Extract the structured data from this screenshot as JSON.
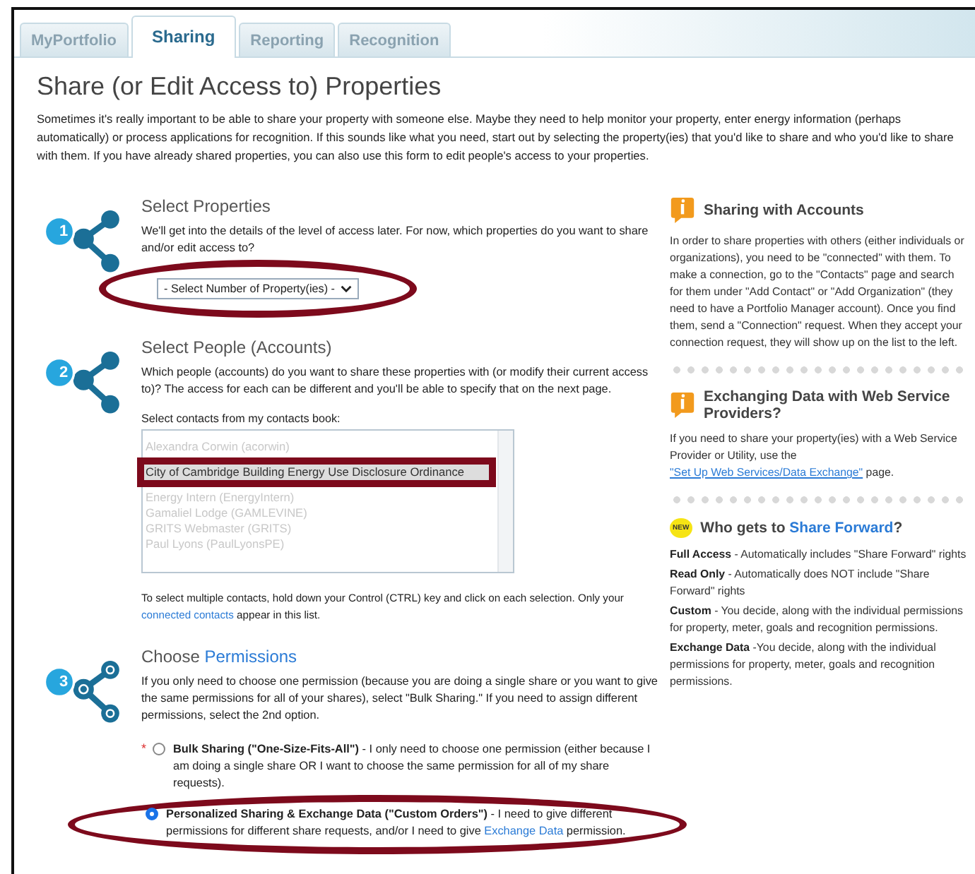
{
  "tabs": [
    {
      "label": "MyPortfolio",
      "selected": false
    },
    {
      "label": "Sharing",
      "selected": true
    },
    {
      "label": "Reporting",
      "selected": false
    },
    {
      "label": "Recognition",
      "selected": false
    }
  ],
  "title": "Share (or Edit Access to) Properties",
  "intro": "Sometimes it's really important to be able to share your property with someone else. Maybe they need to help monitor your property, enter energy information (perhaps automatically) or process applications for recognition. If this sounds like what you need, start out by selecting the property(ies) that you'd like to share and who you'd like to share with them. If you have already shared properties, you can also use this form to edit people's access to your properties.",
  "steps": [
    {
      "number": "1",
      "kind": "select",
      "title": "Select Properties",
      "description": "We'll get into the details of the level of access later. For now, which properties do you want to share and/or edit access to?",
      "select": {
        "value": "- Select Number of Property(ies) -"
      }
    },
    {
      "number": "2",
      "kind": "contacts",
      "title": "Select People (Accounts)",
      "description": "Which people (accounts) do you want to share these properties with (or modify their current access to)? The access for each can be different and you'll be able to specify that on the next page.",
      "list_label": "Select contacts from my contacts book:",
      "contacts": [
        {
          "name": "Alexandra Corwin (acorwin)",
          "selected": false
        },
        {
          "name": "City of Cambridge Building Energy Use Disclosure Ordinance",
          "selected": true
        },
        {
          "name": "Energy Intern (EnergyIntern)",
          "selected": false
        },
        {
          "name": "Gamaliel Lodge (GAMLEVINE)",
          "selected": false
        },
        {
          "name": "GRITS Webmaster (GRITS)",
          "selected": false
        },
        {
          "name": "Paul Lyons (PaulLyonsPE)",
          "selected": false
        }
      ],
      "help": {
        "before": "To select multiple contacts, hold down your Control (CTRL) key and click on each selection. Only your ",
        "link": "connected contacts",
        "after": " appear in this list."
      }
    },
    {
      "number": "3",
      "kind": "permissions",
      "title": "Choose ",
      "title_link": "Permissions",
      "description": "If you only need to choose one permission (because you are doing a single share or you want to give the same permissions for all of your shares), select \"Bulk Sharing.\" If you need to assign different permissions, select the 2nd option.",
      "required_mark": "*",
      "options": [
        {
          "label": "Bulk Sharing (\"One-Size-Fits-All\")",
          "text": " - I only need to choose one permission (either because I am doing a single share OR I want to choose the same permission for all of my share requests).",
          "selected": false
        },
        {
          "label": "Personalized Sharing & Exchange Data (\"Custom Orders\")",
          "text": " - I need to give different permissions for different share requests, and/or I need to give ",
          "link": "Exchange Data",
          "after": " permission.",
          "selected": true
        }
      ]
    }
  ],
  "sidebar": [
    {
      "kind": "info",
      "title": "Sharing with Accounts",
      "text": "In order to share properties with others (either individuals or organizations), you need to be \"connected\" with them. To make a connection, go to the \"Contacts\" page and search for them under \"Add Contact\" or \"Add Organization\" (they need to have a Portfolio Manager account). Once you find them, send a \"Connection\" request. When they accept your connection request, they will show up on the list to the left."
    },
    {
      "kind": "info",
      "title": "Exchanging Data with Web Service Providers?",
      "text": "If you need to share your property(ies) with a Web Service Provider or Utility, use the ",
      "link": "\"Set Up Web Services/Data Exchange\"",
      "after": " page."
    },
    {
      "kind": "new",
      "badge": "NEW",
      "title": "Who gets to ",
      "title_link": "Share Forward",
      "title_after": "?",
      "items": [
        {
          "term": "Full Access",
          "text": " - Automatically includes \"Share Forward\" rights"
        },
        {
          "term": "Read Only",
          "text": " - Automatically does NOT include \"Share Forward\" rights"
        },
        {
          "term": "Custom",
          "text": " - You decide, along with the individual permissions for property, meter, goals and recognition permissions."
        },
        {
          "term": "Exchange Data",
          "text": " -You decide, along with the individual permissions for property, meter, goals and recognition permissions."
        }
      ]
    }
  ]
}
